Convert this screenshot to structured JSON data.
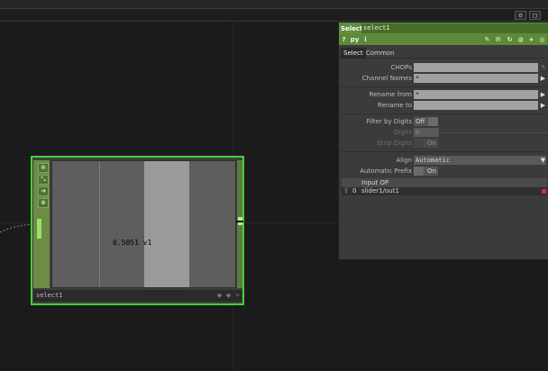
{
  "toolbar": {
    "buttons": [
      "o",
      "□"
    ]
  },
  "node": {
    "name": "select1",
    "value_display": "0.5051 v1",
    "viewer_buttons": [
      "⊕",
      "⤡",
      "➜",
      "⊗"
    ],
    "label_icons": [
      "◆",
      "◆",
      "+"
    ]
  },
  "panel": {
    "type_label": "Select",
    "op_name": "select1",
    "tool_icons": {
      "help": "?",
      "python": "py",
      "info": "i",
      "edit": "✎",
      "comment": "✉",
      "refresh": "↻",
      "globe": "◍",
      "add": "+",
      "target": "◎"
    },
    "tabs": [
      "Select",
      "Common"
    ],
    "params": {
      "chops_label": "CHOPs",
      "chops_value": "",
      "channel_names_label": "Channel Names",
      "channel_names_value": "*",
      "rename_from_label": "Rename from",
      "rename_from_value": "*",
      "rename_to_label": "Rename to",
      "rename_to_value": "",
      "filter_by_digits_label": "Filter by Digits",
      "filter_by_digits_value": "Off",
      "digits_label": "Digits",
      "digits_value": "0",
      "strip_digits_label": "Strip Digits",
      "strip_digits_value": "On",
      "align_label": "Align",
      "align_value": "Automatic",
      "automatic_prefix_label": "Automatic Prefix",
      "automatic_prefix_value": "On"
    },
    "input_table": {
      "header": "Input OP",
      "rows": [
        {
          "index": "0",
          "value": "slider1/out1"
        }
      ]
    }
  },
  "colors": {
    "node_border": "#46cf3a",
    "panel_header": "#5f8e3c",
    "delete": "#c8343a"
  }
}
